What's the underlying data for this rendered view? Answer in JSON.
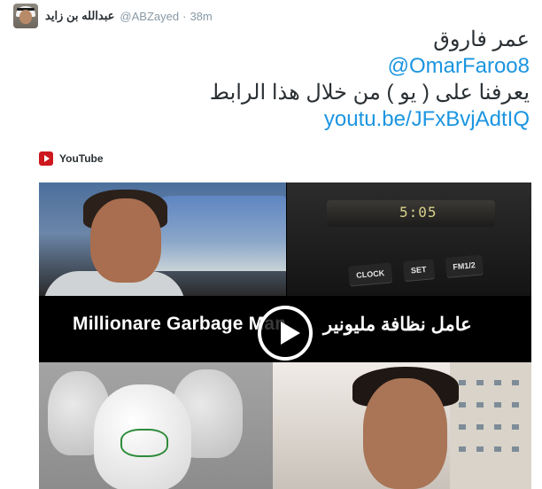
{
  "tweet": {
    "author_name": "عبدالله بن زايد",
    "author_handle": "@ABZayed",
    "separator": "·",
    "timestamp": "38m",
    "lines": [
      {
        "text": "عمر فاروق",
        "kind": "text"
      },
      {
        "text": "@OmarFaroo8",
        "kind": "link"
      },
      {
        "text": "يعرفنا على ( يو ) من خلال هذا الرابط",
        "kind": "text"
      },
      {
        "text": "youtu.be/JFxBvjAdtIQ",
        "kind": "link"
      }
    ]
  },
  "card": {
    "source_label": "YouTube",
    "source_icon": "youtube-icon",
    "video": {
      "title_en": "Millionare Garbage Man",
      "title_ar": "عامل نظافة مليونير",
      "clock_display": "5:05",
      "radio_buttons": [
        "CLOCK",
        "SET",
        "FM1/2"
      ],
      "play_icon": "play-icon"
    }
  },
  "colors": {
    "link": "#1b95e0",
    "meta": "#8899a6",
    "text": "#292f33",
    "youtube_red": "#cc181e"
  }
}
